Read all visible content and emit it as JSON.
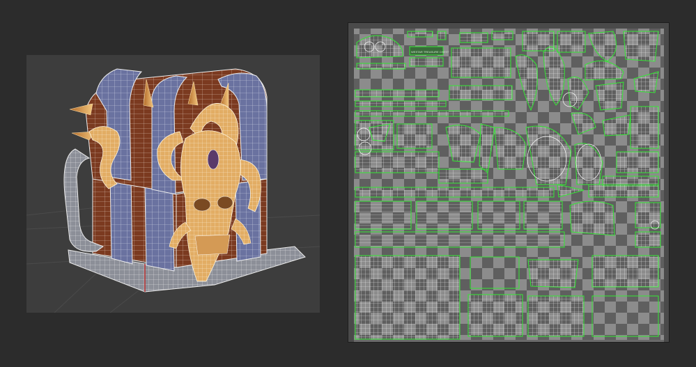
{
  "scene": {
    "viewport_background": "#3d3d3d",
    "editor_background": "#2c2c2c",
    "model": {
      "subject": "treasure chest",
      "wire_color": "#e8e8e8",
      "metal_color": "#6e76a0",
      "wood_color": "#7a3b22",
      "ornament_color": "#e4b26a"
    }
  },
  "uv_editor": {
    "checker_light": "#8a8a8a",
    "checker_dark": "#5c5c5c",
    "island_border_color": "#32e832",
    "island_wire_color": "#ffffff",
    "stamp_text": "WESTAR TREASURE CHEST"
  }
}
